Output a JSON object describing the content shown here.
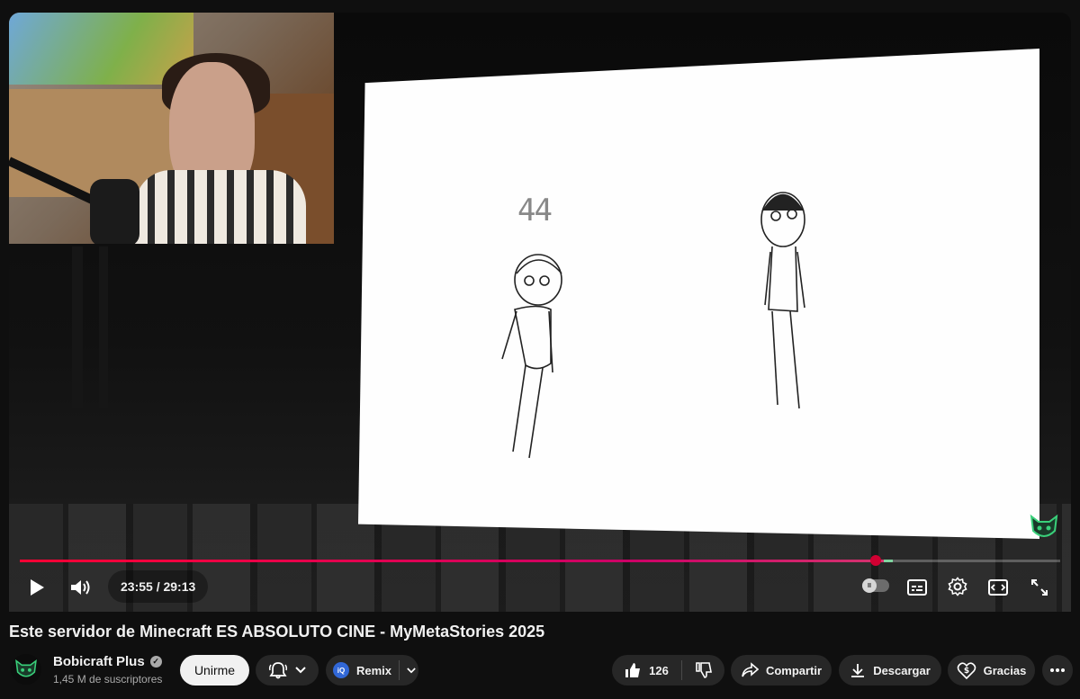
{
  "video": {
    "current_time": "23:55",
    "duration": "29:13",
    "time_separator": " / ",
    "progress_fraction": 0.818,
    "drawing_text": "44"
  },
  "title": "Este servidor de Minecraft ES ABSOLUTO CINE - MyMetaStories 2025",
  "channel": {
    "name": "Bobicraft Plus",
    "subscribers": "1,45 M de suscriptores"
  },
  "actions": {
    "join_label": "Unirme",
    "remix_label": "Remix",
    "likes": "126",
    "share_label": "Compartir",
    "download_label": "Descargar",
    "thanks_label": "Gracias"
  },
  "colors": {
    "progress": "#ff0033",
    "scrubber": "#d10032",
    "background": "#0f0f0f",
    "pill": "#272727"
  },
  "icons": [
    "play-icon",
    "volume-icon",
    "autoplay-toggle",
    "subtitles-icon",
    "settings-icon",
    "theater-icon",
    "fullscreen-icon",
    "bell-icon",
    "chevron-down-icon",
    "like-icon",
    "dislike-icon",
    "share-icon",
    "download-icon",
    "thanks-icon",
    "more-icon"
  ]
}
